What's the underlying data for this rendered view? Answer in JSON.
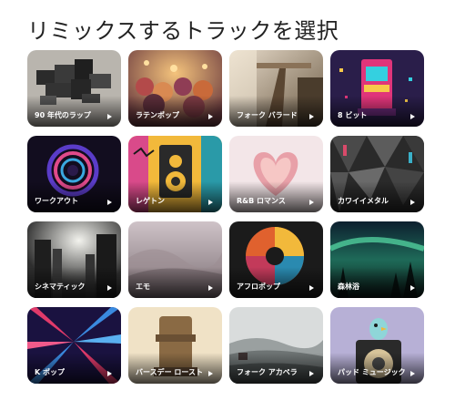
{
  "page": {
    "title": "リミックスするトラックを選択"
  },
  "cards": [
    {
      "label": "90 年代のラップ"
    },
    {
      "label": "ラテンポップ"
    },
    {
      "label": "フォーク バラード"
    },
    {
      "label": "8 ビット"
    },
    {
      "label": "ワークアウト"
    },
    {
      "label": "レゲトン"
    },
    {
      "label": "R&B ロマンス"
    },
    {
      "label": "カワイイメタル"
    },
    {
      "label": "シネマティック"
    },
    {
      "label": "エモ"
    },
    {
      "label": "アフロポップ"
    },
    {
      "label": "森林浴"
    },
    {
      "label": "K ポップ"
    },
    {
      "label": "バースデー ロースト"
    },
    {
      "label": "フォーク アカペラ"
    },
    {
      "label": "パッド ミュージック"
    }
  ],
  "icons": {
    "card_play": "play-icon"
  }
}
